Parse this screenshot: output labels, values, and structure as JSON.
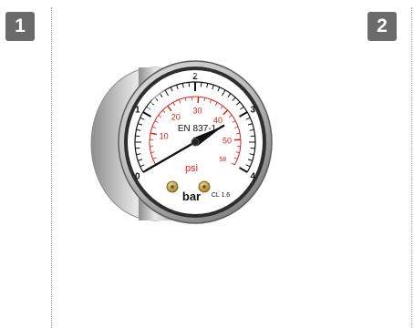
{
  "panels": [
    {
      "number": "1"
    },
    {
      "number": "2"
    }
  ],
  "gauge": {
    "bar_scale": [
      "0",
      "1",
      "2",
      "3",
      "4"
    ],
    "psi_scale": [
      "10",
      "20",
      "30",
      "40",
      "50",
      "58"
    ],
    "standard": "EN 837-1",
    "psi_unit": "psi",
    "bar_unit": "bar",
    "accuracy_class": "CL 1.6",
    "pointer_value_bar": 0.0,
    "colors": {
      "bar_scale": "#111111",
      "psi_scale": "#d9221c",
      "bezel": "#b8b8b8",
      "dial": "#ffffff"
    }
  }
}
